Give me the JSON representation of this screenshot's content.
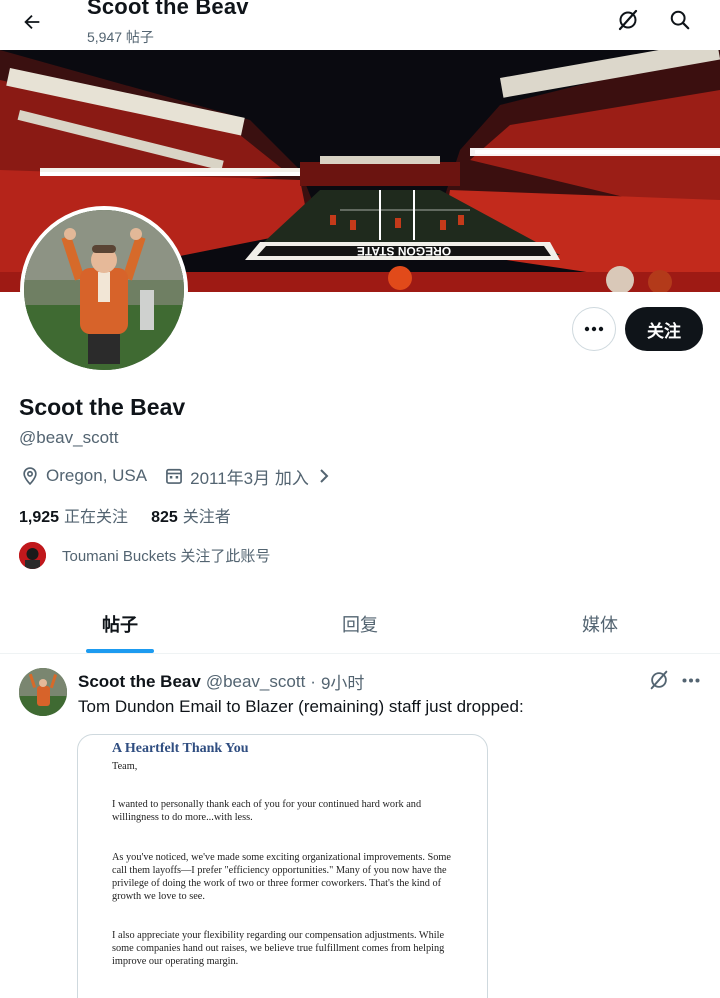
{
  "header": {
    "title": "Scoot the Beav",
    "post_count": "5,947 帖子"
  },
  "profile": {
    "name": "Scoot the Beav",
    "handle": "@beav_scott",
    "location": "Oregon, USA",
    "joined": "2011年3月 加入",
    "following_count": "1,925",
    "following_label": "正在关注",
    "followers_count": "825",
    "followers_label": "关注者",
    "followed_by": "Toumani Buckets 关注了此账号",
    "follow_button": "关注",
    "banner_field_text": "OREGON STATE"
  },
  "tabs": [
    {
      "label": "帖子",
      "active": true
    },
    {
      "label": "回复",
      "active": false
    },
    {
      "label": "媒体",
      "active": false
    }
  ],
  "tweet": {
    "name": "Scoot the Beav",
    "handle": "@beav_scott",
    "separator": "·",
    "time": "9小时",
    "text": "Tom Dundon Email to Blazer (remaining) staff just dropped:",
    "document": {
      "title": "A Heartfelt Thank You",
      "paragraphs": [
        "Team,",
        "I wanted to personally thank each of you for your continued hard work and willingness to do more...with less.",
        "As you've noticed, we've made some exciting organizational improvements. Some call them layoffs—I prefer \"efficiency opportunities.\" Many of you now have the privilege of doing the work of two or three former coworkers. That's the kind of growth we love to see.",
        "I also appreciate your flexibility regarding our compensation adjustments. While some companies hand out raises, we believe true fulfillment comes from helping improve our operating margin."
      ]
    }
  },
  "colors": {
    "accent": "#1d9bf0",
    "text_primary": "#0f1419",
    "text_secondary": "#536471",
    "button_dark": "#0f1419",
    "orange": "#e35b1b"
  },
  "icons": {
    "back": "arrow-left-icon",
    "grok": "grok-icon",
    "search": "search-icon",
    "more": "ellipsis-icon",
    "location": "location-pin-icon",
    "calendar": "calendar-icon"
  }
}
